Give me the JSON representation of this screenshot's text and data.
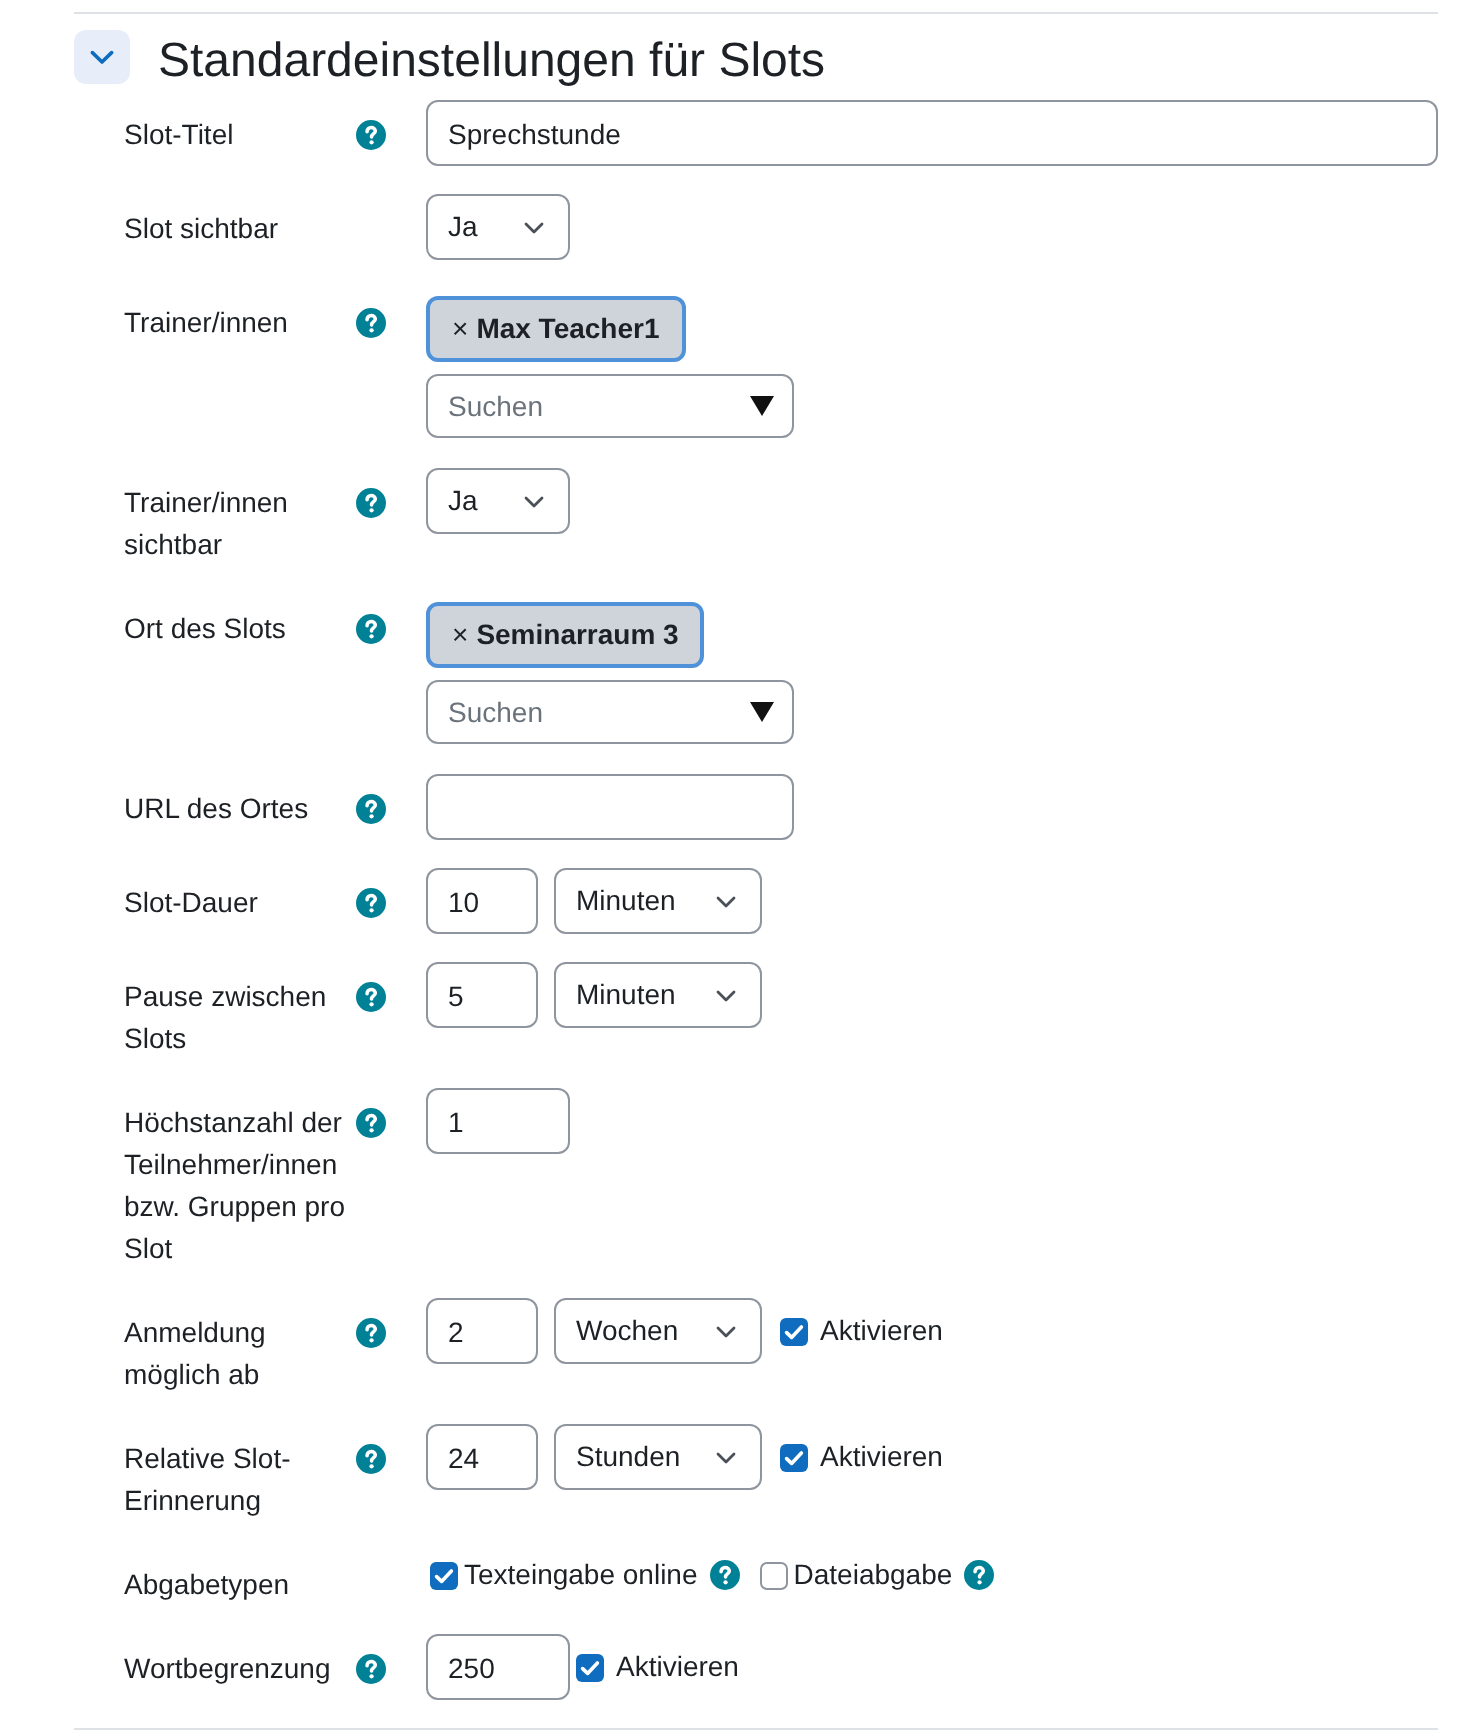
{
  "section": {
    "title": "Standardeinstellungen für Slots",
    "expanded": true
  },
  "fields": [
    {
      "kind": "text",
      "label": "Slot-Titel",
      "help": true,
      "value": "Sprechstunde"
    },
    {
      "kind": "select",
      "label": "Slot sichtbar",
      "help": false,
      "value": "Ja"
    },
    {
      "kind": "autocomplete",
      "label": "Trainer/innen",
      "help": true,
      "chips": [
        {
          "remove": "×",
          "label": "Max Teacher1"
        }
      ],
      "placeholder": "Suchen"
    },
    {
      "kind": "select",
      "label": "Trainer/innen sichtbar",
      "help": true,
      "value": "Ja"
    },
    {
      "kind": "autocomplete",
      "label": "Ort des Slots",
      "help": true,
      "chips": [
        {
          "remove": "×",
          "label": "Seminarraum 3"
        }
      ],
      "placeholder": "Suchen"
    },
    {
      "kind": "url",
      "label": "URL des Ortes",
      "help": true
    },
    {
      "kind": "duration",
      "label": "Slot-Dauer",
      "help": true,
      "value": "10",
      "unit": "Minuten"
    },
    {
      "kind": "duration",
      "label": "Pause zwischen Slots",
      "help": true,
      "value": "5",
      "unit": "Minuten"
    },
    {
      "kind": "number",
      "label": "Höchstanzahl der Teilnehmer/innen bzw. Gruppen pro Slot",
      "help": true,
      "value": "1"
    },
    {
      "kind": "duration",
      "label": "Anmeldung möglich ab",
      "help": true,
      "value": "2",
      "unit": "Wochen",
      "enable": {
        "label": "Aktivieren",
        "checked": true
      }
    },
    {
      "kind": "duration",
      "label": "Relative Slot-Erinnerung",
      "help": true,
      "value": "24",
      "unit": "Stunden",
      "enable": {
        "label": "Aktivieren",
        "checked": true
      }
    },
    {
      "kind": "checkboxes",
      "label": "Abgabetypen",
      "help": false,
      "options": [
        {
          "label": "Texteingabe online",
          "checked": true,
          "help": true
        },
        {
          "label": "Dateiabgabe",
          "checked": false,
          "help": true
        }
      ]
    },
    {
      "kind": "number",
      "label": "Wortbegrenzung",
      "help": true,
      "value": "250",
      "enable": {
        "label": "Aktivieren",
        "checked": true
      }
    }
  ]
}
